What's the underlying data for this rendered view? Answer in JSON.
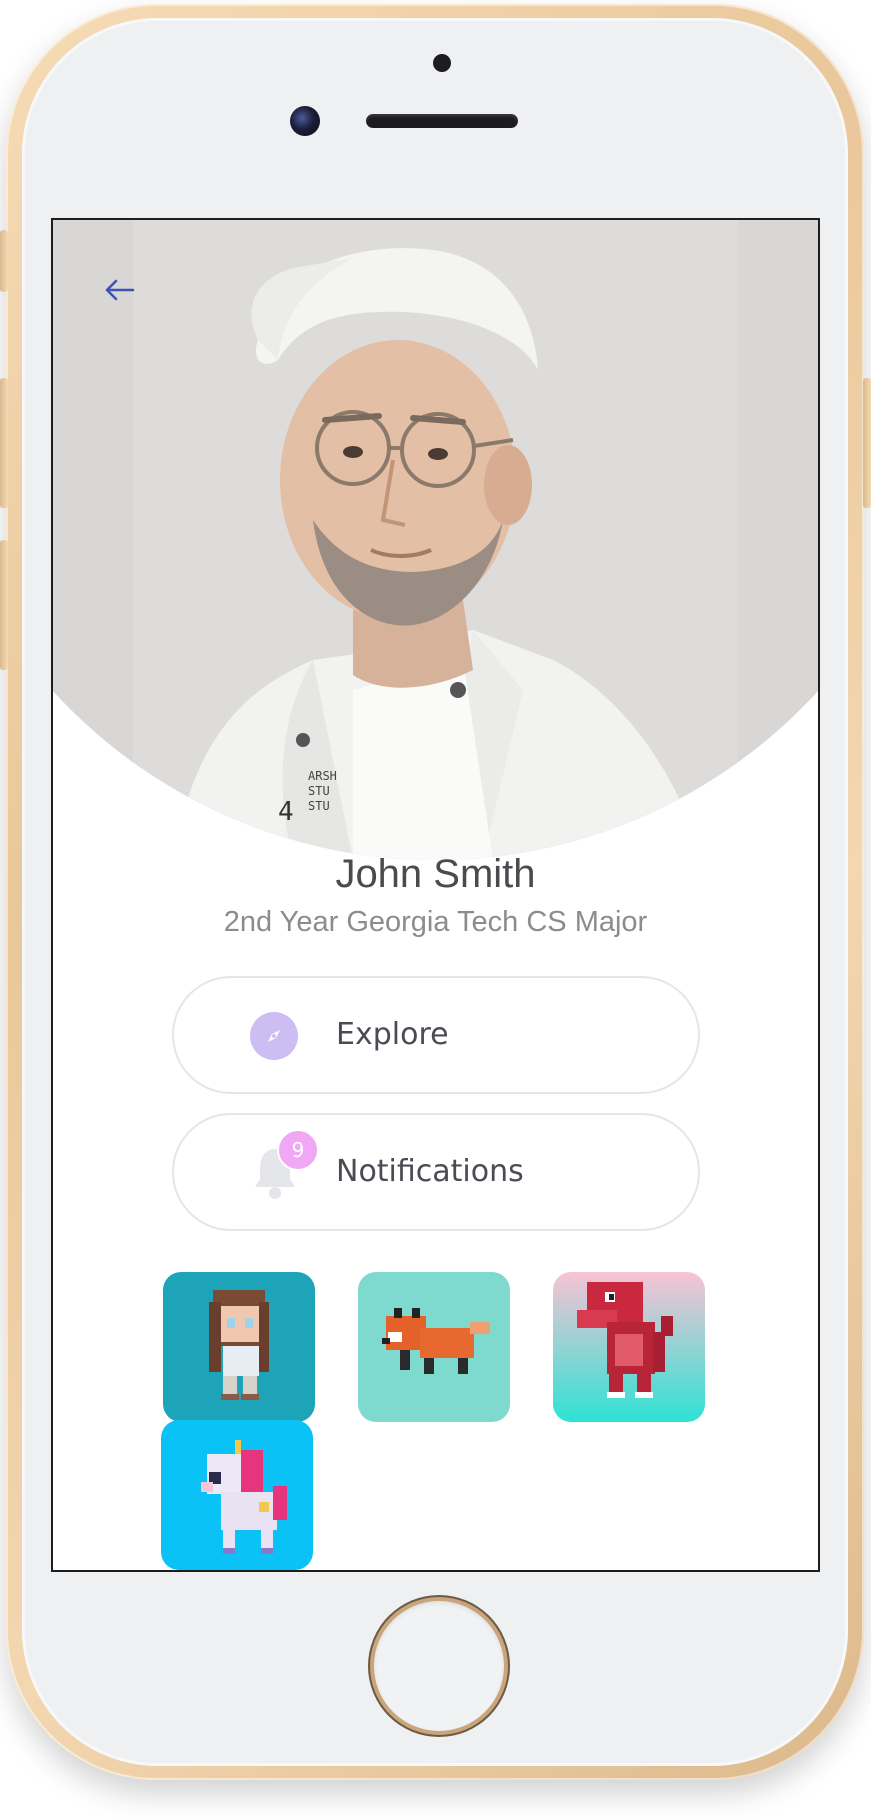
{
  "profile": {
    "name": "John Smith",
    "subtitle": "2nd Year Georgia Tech CS Major"
  },
  "menu": {
    "explore_label": "Explore",
    "notifications_label": "Notifications",
    "notifications_count": "9"
  },
  "avatars": [
    {
      "name": "girl-character",
      "bg": "#1ea4b9"
    },
    {
      "name": "fox-character",
      "bg": "#7ed9cf"
    },
    {
      "name": "dinosaur-character",
      "bg": "#f7c3d4"
    },
    {
      "name": "unicorn-character",
      "bg": "#0ac2f5"
    }
  ],
  "colors": {
    "accent": "#3f51b5",
    "explore_icon_bg": "#cdbdf2",
    "badge": "#f0a7f4"
  },
  "icons": {
    "back": "arrow-left-icon",
    "explore": "compass-icon",
    "notifications": "bell-icon"
  }
}
